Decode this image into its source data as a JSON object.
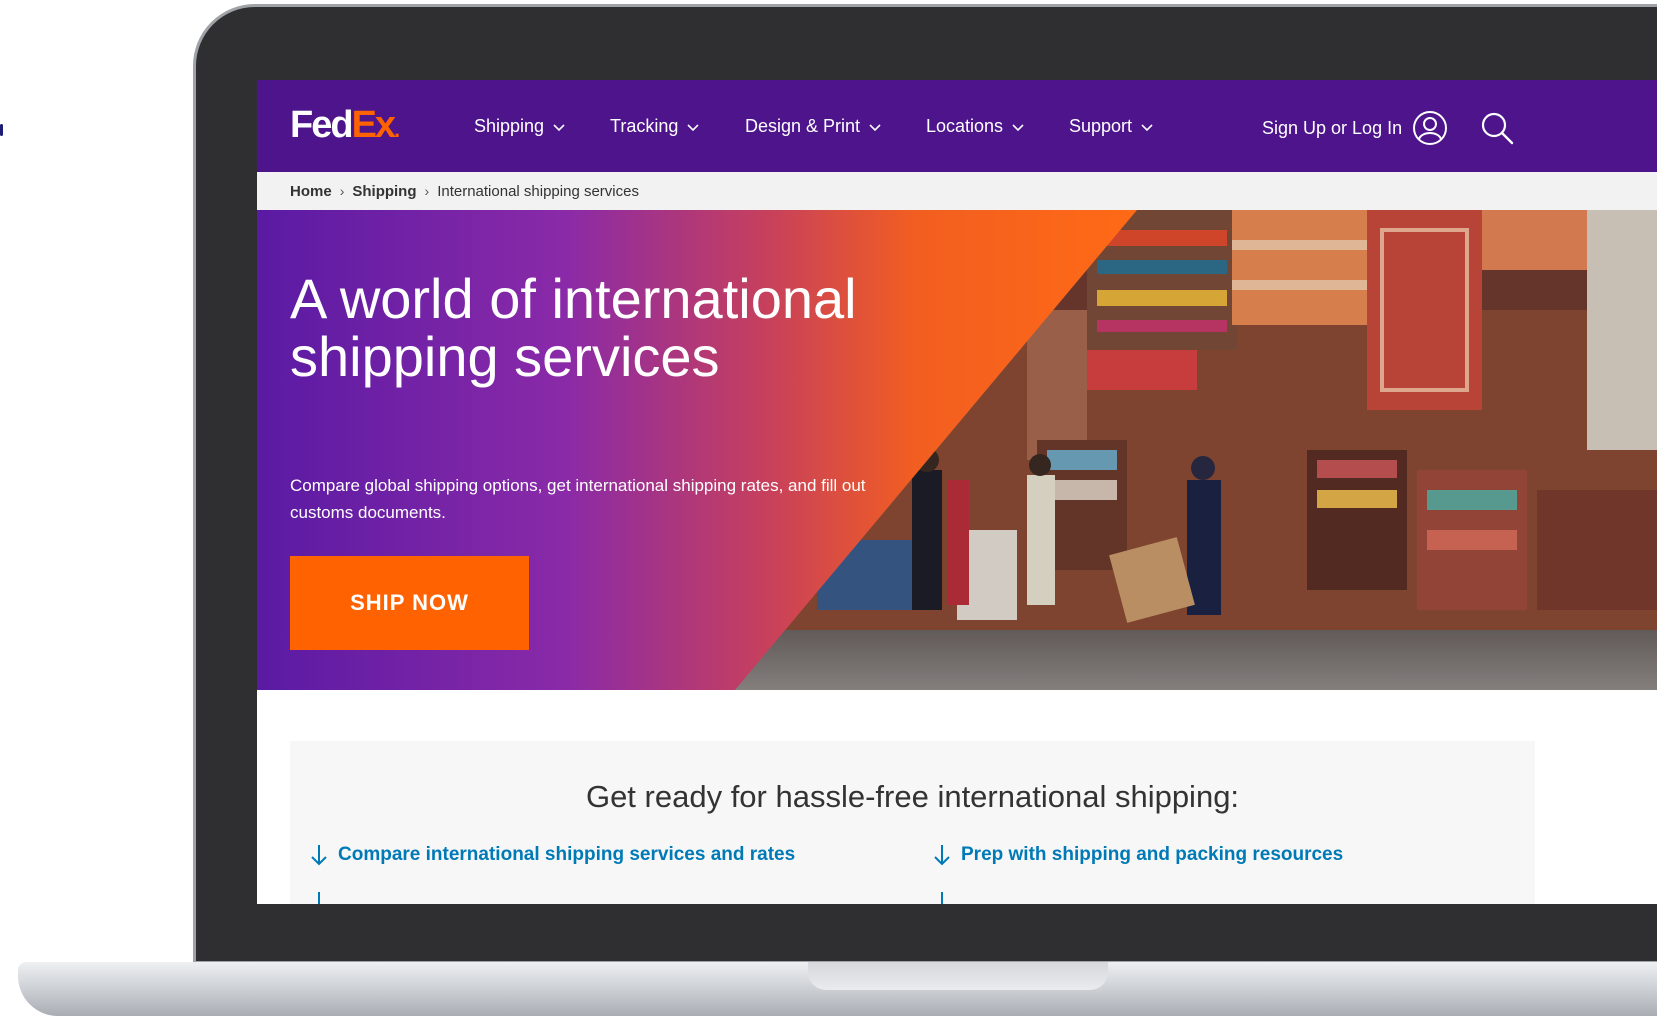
{
  "brand": {
    "logo_fed": "Fed",
    "logo_ex": "Ex",
    "logo_dot": ".",
    "purple": "#4d148c",
    "orange": "#ff6200"
  },
  "nav": {
    "items": [
      {
        "label": "Shipping",
        "icon": "chevron-down-icon"
      },
      {
        "label": "Tracking",
        "icon": "chevron-down-icon"
      },
      {
        "label": "Design & Print",
        "icon": "chevron-down-icon"
      },
      {
        "label": "Locations",
        "icon": "chevron-down-icon"
      },
      {
        "label": "Support",
        "icon": "chevron-down-icon"
      }
    ],
    "sign_in_label": "Sign Up or Log In",
    "user_icon": "user-icon",
    "search_icon": "search-icon"
  },
  "breadcrumb": {
    "home": "Home",
    "shipping": "Shipping",
    "current": "International shipping services"
  },
  "hero": {
    "title": "A world of international shipping services",
    "subtitle": "Compare global shipping options, get international shipping rates, and fill out  customs documents.",
    "cta_label": "SHIP NOW"
  },
  "section": {
    "title": "Get ready for hassle-free international shipping:",
    "links": [
      {
        "label": "Compare international shipping services and rates",
        "icon": "arrow-down-icon"
      },
      {
        "label": "Prep with shipping and packing resources",
        "icon": "arrow-down-icon"
      },
      {
        "label": "",
        "icon": "arrow-down-icon"
      },
      {
        "label": "",
        "icon": "arrow-down-icon"
      }
    ]
  }
}
